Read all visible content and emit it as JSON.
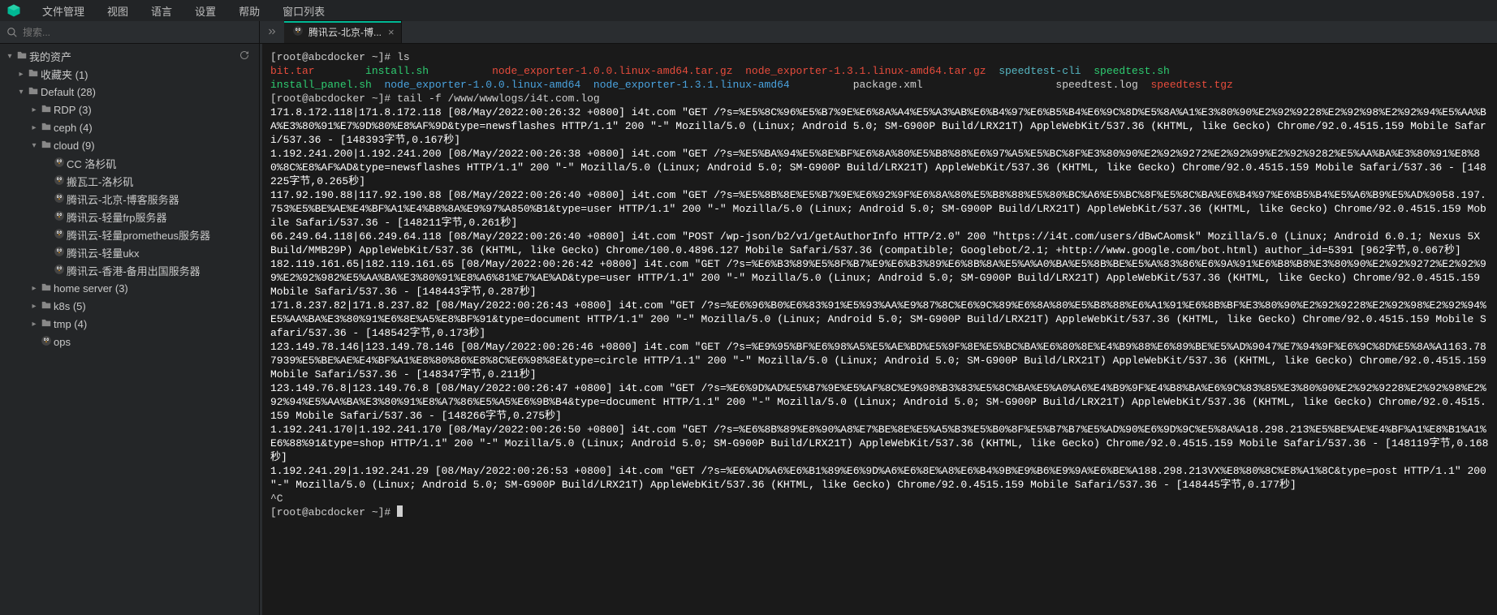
{
  "menu": {
    "items": [
      "文件管理",
      "视图",
      "语言",
      "设置",
      "帮助",
      "窗口列表"
    ]
  },
  "search": {
    "placeholder": "搜索..."
  },
  "tab": {
    "label": "腾讯云-北京-博...",
    "close": "×"
  },
  "tree": [
    {
      "lvl": 0,
      "chev": "▾",
      "icon": "folder",
      "label": "我的资产",
      "trail": "refresh"
    },
    {
      "lvl": 1,
      "chev": "▸",
      "icon": "folder",
      "label": "收藏夹 (1)"
    },
    {
      "lvl": 1,
      "chev": "▾",
      "icon": "folder",
      "label": "Default (28)"
    },
    {
      "lvl": 2,
      "chev": "▸",
      "icon": "folder",
      "label": "RDP (3)"
    },
    {
      "lvl": 2,
      "chev": "▸",
      "icon": "folder",
      "label": "ceph (4)"
    },
    {
      "lvl": 2,
      "chev": "▾",
      "icon": "folder",
      "label": "cloud (9)"
    },
    {
      "lvl": 3,
      "chev": "",
      "icon": "linux",
      "label": "CC 洛杉矶"
    },
    {
      "lvl": 3,
      "chev": "",
      "icon": "linux",
      "label": "搬瓦工-洛杉矶"
    },
    {
      "lvl": 3,
      "chev": "",
      "icon": "linux",
      "label": "腾讯云-北京-博客服务器"
    },
    {
      "lvl": 3,
      "chev": "",
      "icon": "linux",
      "label": "腾讯云-轻量frp服务器"
    },
    {
      "lvl": 3,
      "chev": "",
      "icon": "linux",
      "label": "腾讯云-轻量prometheus服务器"
    },
    {
      "lvl": 3,
      "chev": "",
      "icon": "linux",
      "label": "腾讯云-轻量ukx"
    },
    {
      "lvl": 3,
      "chev": "",
      "icon": "linux",
      "label": "腾讯云-香港-备用出国服务器"
    },
    {
      "lvl": 2,
      "chev": "▸",
      "icon": "folder",
      "label": "home server (3)"
    },
    {
      "lvl": 2,
      "chev": "▸",
      "icon": "folder",
      "label": "k8s (5)"
    },
    {
      "lvl": 2,
      "chev": "▸",
      "icon": "folder",
      "label": "tmp (4)"
    },
    {
      "lvl": 2,
      "chev": "",
      "icon": "linux",
      "label": "ops"
    }
  ],
  "terminal": {
    "prompt": "[root@abcdocker ~]# ",
    "cmd1": "ls",
    "ls": {
      "r1": [
        "bit.tar",
        "install.sh",
        "node_exporter-1.0.0.linux-amd64.tar.gz",
        "node_exporter-1.3.1.linux-amd64.tar.gz",
        "speedtest-cli",
        "speedtest.sh"
      ],
      "r2": [
        "install_panel.sh",
        "node_exporter-1.0.0.linux-amd64",
        "node_exporter-1.3.1.linux-amd64",
        "package.xml",
        "speedtest.log",
        "speedtest.tgz"
      ]
    },
    "cmd2": "tail -f /www/wwwlogs/i4t.com.log",
    "log": [
      "171.8.172.118|171.8.172.118 [08/May/2022:00:26:32 +0800] i4t.com \"GET /?s=%E5%8C%96%E5%B7%9E%E6%8A%A4%E5%A3%AB%E6%B4%97%E6%B5%B4%E6%9C%8D%E5%8A%A1%E3%80%90%E2%92%9228%E2%92%98%E2%92%94%E5%AA%BA%E3%80%91%E7%9D%80%E8%AF%9D&type=newsflashes HTTP/1.1\" 200 \"-\" Mozilla/5.0 (Linux; Android 5.0; SM-G900P Build/LRX21T) AppleWebKit/537.36 (KHTML, like Gecko) Chrome/92.0.4515.159 Mobile Safari/537.36 - [148393字节,0.167秒]",
      "1.192.241.200|1.192.241.200 [08/May/2022:00:26:38 +0800] i4t.com \"GET /?s=%E5%BA%94%E5%8E%BF%E6%8A%80%E5%B8%88%E6%97%A5%E5%BC%8F%E3%80%90%E2%92%9272%E2%92%99%E2%92%9282%E5%AA%BA%E3%80%91%E8%80%8C%E8%AF%AD&type=newsflashes HTTP/1.1\" 200 \"-\" Mozilla/5.0 (Linux; Android 5.0; SM-G900P Build/LRX21T) AppleWebKit/537.36 (KHTML, like Gecko) Chrome/92.0.4515.159 Mobile Safari/537.36 - [148225字节,0.265秒]",
      "117.92.190.88|117.92.190.88 [08/May/2022:00:26:40 +0800] i4t.com \"GET /?s=%E5%8B%8E%E5%B7%9E%E6%92%9F%E6%8A%80%E5%B8%88%E5%80%BC%A6%E5%BC%8F%E5%8C%BA%E6%B4%97%E6%B5%B4%E5%A6%B9%E5%AD%9058.197.753%E5%BE%AE%E4%BF%A1%E4%B8%8A%E9%97%A850%B1&type=user HTTP/1.1\" 200 \"-\" Mozilla/5.0 (Linux; Android 5.0; SM-G900P Build/LRX21T) AppleWebKit/537.36 (KHTML, like Gecko) Chrome/92.0.4515.159 Mobile Safari/537.36 - [148211字节,0.261秒]",
      "66.249.64.118|66.249.64.118 [08/May/2022:00:26:40 +0800] i4t.com \"POST /wp-json/b2/v1/getAuthorInfo HTTP/2.0\" 200 \"https://i4t.com/users/dBwCAomsk\" Mozilla/5.0 (Linux; Android 6.0.1; Nexus 5X Build/MMB29P) AppleWebKit/537.36 (KHTML, like Gecko) Chrome/100.0.4896.127 Mobile Safari/537.36 (compatible; Googlebot/2.1; +http://www.google.com/bot.html) author_id=5391 [962字节,0.067秒]",
      "182.119.161.65|182.119.161.65 [08/May/2022:00:26:42 +0800] i4t.com \"GET /?s=%E6%B3%89%E5%8F%B7%E9%E6%B3%89%E6%8B%8A%E5%A%A0%BA%E5%8B%BE%E5%A%83%86%E6%9A%91%E6%B8%B8%E3%80%90%E2%92%9272%E2%92%99%E2%92%982%E5%AA%BA%E3%80%91%E8%A6%81%E7%AE%AD&type=user HTTP/1.1\" 200 \"-\" Mozilla/5.0 (Linux; Android 5.0; SM-G900P Build/LRX21T) AppleWebKit/537.36 (KHTML, like Gecko) Chrome/92.0.4515.159 Mobile Safari/537.36 - [148443字节,0.287秒]",
      "171.8.237.82|171.8.237.82 [08/May/2022:00:26:43 +0800] i4t.com \"GET /?s=%E6%96%B0%E6%83%91%E5%93%AA%E9%87%8C%E6%9C%89%E6%8A%80%E5%B8%88%E6%A1%91%E6%8B%BF%E3%80%90%E2%92%9228%E2%92%98%E2%92%94%E5%AA%BA%E3%80%91%E6%8E%A5%E8%BF%91&type=document HTTP/1.1\" 200 \"-\" Mozilla/5.0 (Linux; Android 5.0; SM-G900P Build/LRX21T) AppleWebKit/537.36 (KHTML, like Gecko) Chrome/92.0.4515.159 Mobile Safari/537.36 - [148542字节,0.173秒]",
      "123.149.78.146|123.149.78.146 [08/May/2022:00:26:46 +0800] i4t.com \"GET /?s=%E9%95%BF%E6%98%A5%E5%AE%BD%E5%9F%8E%E5%BC%BA%E6%80%8E%E4%B9%88%E6%89%BE%E5%AD%9047%E7%94%9F%E6%9C%8D%E5%8A%A1163.787939%E5%BE%AE%E4%BF%A1%E8%80%86%E8%8C%E6%98%8E&type=circle HTTP/1.1\" 200 \"-\" Mozilla/5.0 (Linux; Android 5.0; SM-G900P Build/LRX21T) AppleWebKit/537.36 (KHTML, like Gecko) Chrome/92.0.4515.159 Mobile Safari/537.36 - [148347字节,0.211秒]",
      "123.149.76.8|123.149.76.8 [08/May/2022:00:26:47 +0800] i4t.com \"GET /?s=%E6%9D%AD%E5%B7%9E%E5%AF%8C%E9%98%B3%83%E5%8C%BA%E5%A0%A6%E4%B9%9F%E4%B8%BA%E6%9C%83%85%E3%80%90%E2%92%9228%E2%92%98%E2%92%94%E5%AA%BA%E3%80%91%E8%A7%86%E5%A5%E6%9B%B4&type=document HTTP/1.1\" 200 \"-\" Mozilla/5.0 (Linux; Android 5.0; SM-G900P Build/LRX21T) AppleWebKit/537.36 (KHTML, like Gecko) Chrome/92.0.4515.159 Mobile Safari/537.36 - [148266字节,0.275秒]",
      "1.192.241.170|1.192.241.170 [08/May/2022:00:26:50 +0800] i4t.com \"GET /?s=%E6%8B%89%E8%90%A8%E7%BE%8E%E5%A5%B3%E5%B0%8F%E5%B7%B7%E5%AD%90%E6%9D%9C%E5%8A%A18.298.213%E5%BE%AE%E4%BF%A1%E8%B1%A1%E6%88%91&type=shop HTTP/1.1\" 200 \"-\" Mozilla/5.0 (Linux; Android 5.0; SM-G900P Build/LRX21T) AppleWebKit/537.36 (KHTML, like Gecko) Chrome/92.0.4515.159 Mobile Safari/537.36 - [148119字节,0.168秒]",
      "1.192.241.29|1.192.241.29 [08/May/2022:00:26:53 +0800] i4t.com \"GET /?s=%E6%AD%A6%E6%B1%89%E6%9D%A6%E6%8E%A8%E6%B4%9B%E9%B6%E9%9A%E6%BE%A188.298.213VX%E8%80%8C%E8%A1%8C&type=post HTTP/1.1\" 200 \"-\" Mozilla/5.0 (Linux; Android 5.0; SM-G900P Build/LRX21T) AppleWebKit/537.36 (KHTML, like Gecko) Chrome/92.0.4515.159 Mobile Safari/537.36 - [148445字节,0.177秒]"
    ],
    "ctrlc": "^C"
  }
}
